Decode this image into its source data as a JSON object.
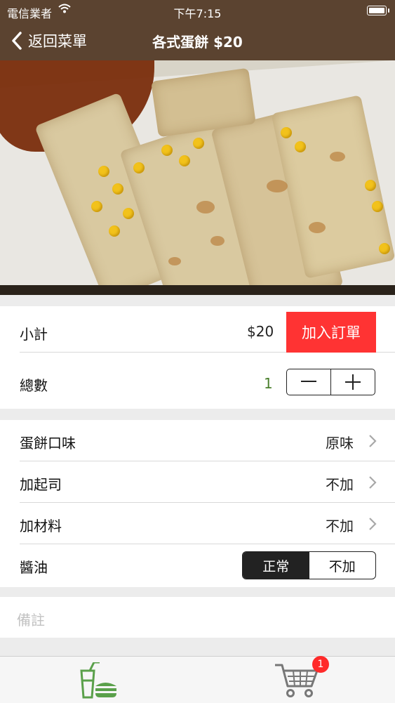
{
  "status_bar": {
    "carrier": "電信業者",
    "time": "下午7:15"
  },
  "nav": {
    "back_label": "返回菜單",
    "title": "各式蛋餅 $20"
  },
  "order": {
    "subtotal_label": "小計",
    "subtotal_value": "$20",
    "add_button_label": "加入訂單",
    "quantity_label": "總數",
    "quantity_value": "1",
    "minus_symbol": "—",
    "plus_symbol": "+"
  },
  "options": [
    {
      "label": "蛋餅口味",
      "value": "原味"
    },
    {
      "label": "加起司",
      "value": "不加"
    },
    {
      "label": "加材料",
      "value": "不加"
    }
  ],
  "soy_sauce": {
    "label": "醬油",
    "choices": [
      "正常",
      "不加"
    ],
    "selected": "正常"
  },
  "note": {
    "placeholder": "備註"
  },
  "tab_bar": {
    "cart_badge": "1"
  },
  "colors": {
    "nav_bg": "#5b4330",
    "add_button": "#ff3333",
    "quantity_text": "#4a7f2c",
    "menu_icon": "#5aa04a"
  }
}
